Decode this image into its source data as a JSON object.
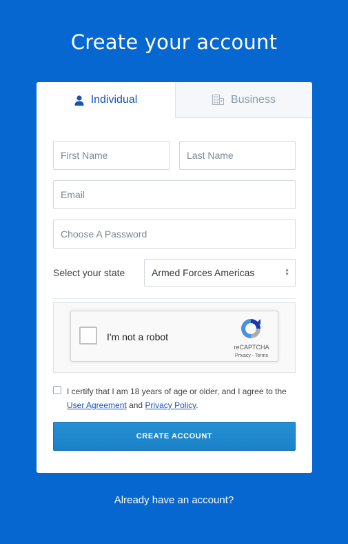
{
  "page": {
    "title": "Create your account"
  },
  "tabs": [
    {
      "label": "Individual",
      "icon": "person-icon",
      "active": true
    },
    {
      "label": "Business",
      "icon": "building-icon",
      "active": false
    }
  ],
  "form": {
    "first_name_placeholder": "First Name",
    "last_name_placeholder": "Last Name",
    "email_placeholder": "Email",
    "password_placeholder": "Choose A Password",
    "state_label": "Select your state",
    "state_value": "Armed Forces Americas"
  },
  "captcha": {
    "label": "I'm not a robot",
    "brand": "reCAPTCHA",
    "links": "Privacy - Terms"
  },
  "agreement": {
    "text_before": "I certify that I am 18 years of age or older, and I agree to the",
    "user_agreement": "User Agreement",
    "and": "and",
    "privacy_policy": "Privacy Policy",
    "period": "."
  },
  "submit_label": "CREATE ACCOUNT",
  "login_link": "Already have an account?",
  "colors": {
    "background": "#0667d0",
    "accent": "#1652b8",
    "button": "#1e88ce"
  }
}
